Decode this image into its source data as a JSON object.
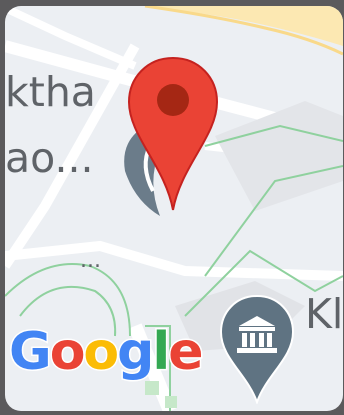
{
  "map": {
    "labels": {
      "top_line": "ktha",
      "bottom_line": "ao...",
      "right_edge": "Kl",
      "ellipsis": "..."
    },
    "logo": {
      "letters": [
        {
          "char": "G",
          "color": "#4285F4"
        },
        {
          "char": "o",
          "color": "#EA4335"
        },
        {
          "char": "o",
          "color": "#FBBC05"
        },
        {
          "char": "g",
          "color": "#4285F4"
        },
        {
          "char": "l",
          "color": "#34A853"
        },
        {
          "char": "e",
          "color": "#EA4335"
        }
      ]
    },
    "colors": {
      "background": "#eceff3",
      "road": "#ffffff",
      "park_outline": "#8fd19e",
      "highway": "#fce8b2",
      "pin_red": "#ea4335",
      "pin_dark_red": "#a52714",
      "poi_gray": "#5f7382"
    },
    "icons": {
      "selected_pin": "location-pin-icon",
      "poi_building": "museum-icon",
      "poi_generic": "place-marker-icon"
    }
  }
}
